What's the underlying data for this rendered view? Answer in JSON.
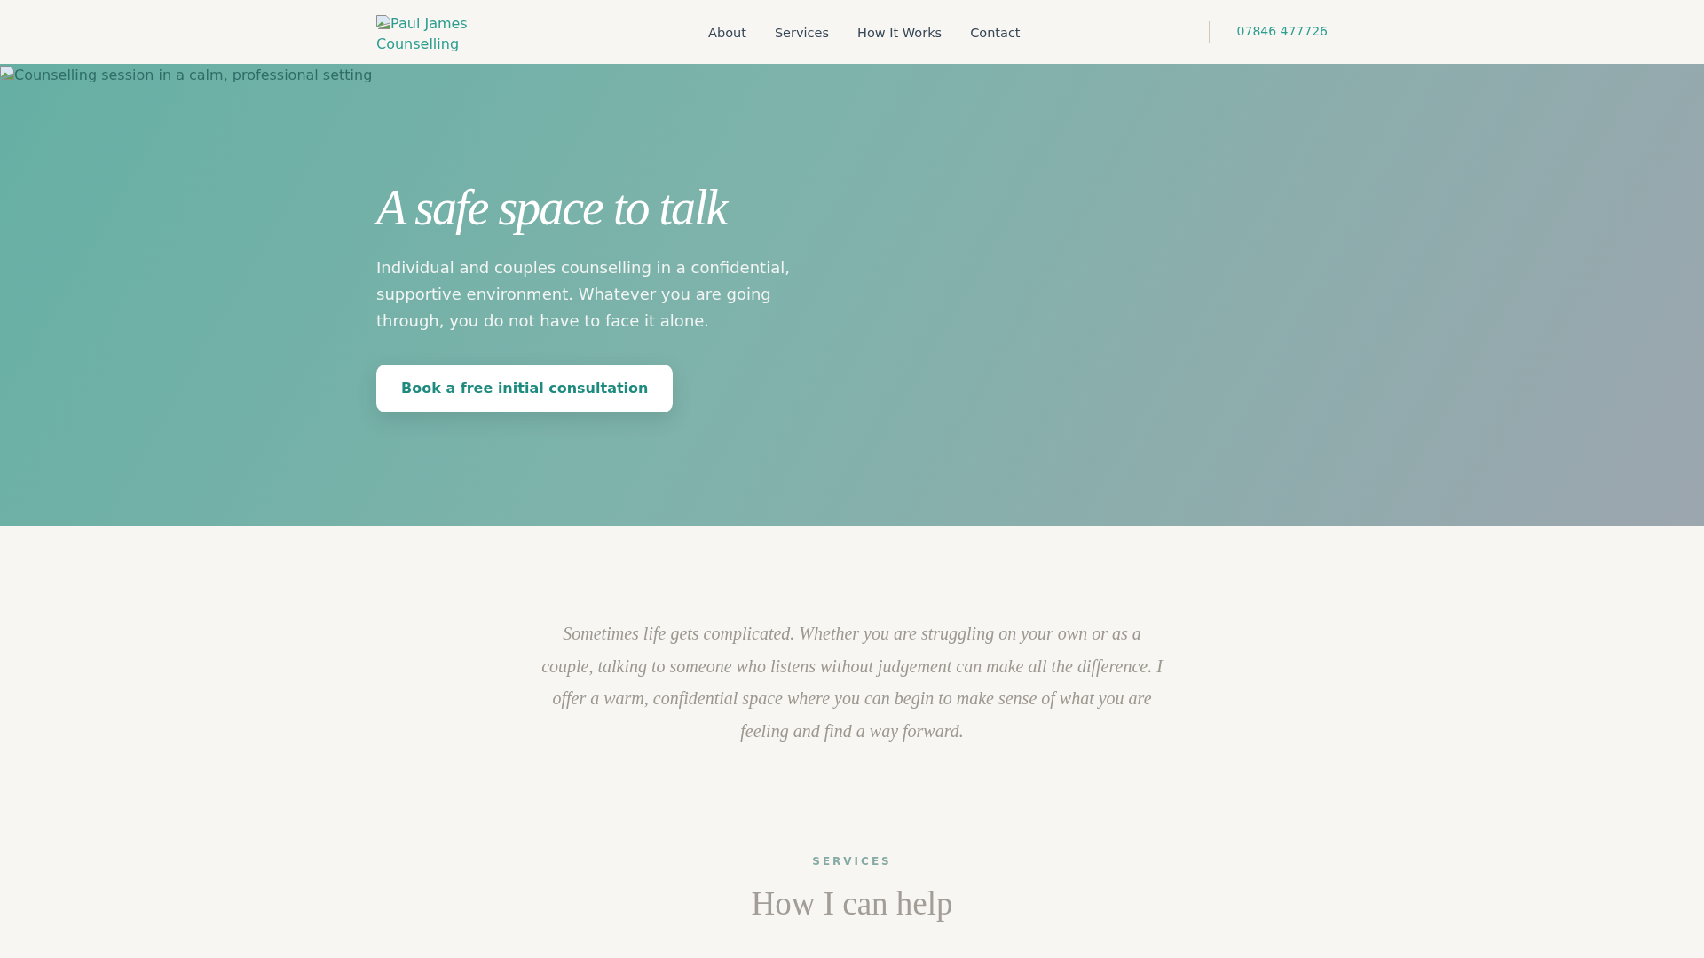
{
  "header": {
    "logo": {
      "alt_text": "Paul James Counselling"
    },
    "nav": [
      "About",
      "Services",
      "How It Works",
      "Contact"
    ],
    "phone": "07846 477726"
  },
  "hero": {
    "image_alt": "Counselling session in a calm, professional setting",
    "title": "A safe space to talk",
    "text": "Individual and couples counselling in a confidential, supportive environment. Whatever you are going through, you do not have to face it alone.",
    "button": "Book a free initial consultation"
  },
  "intro": {
    "text": "Sometimes life gets complicated. Whether you are struggling on your own or as a couple, talking to someone who listens without judgement can make all the difference. I offer a warm, confidential space where you can begin to make sense of what you are feeling and find a way forward."
  },
  "services": {
    "eyebrow": "SERVICES",
    "title": "How I can help"
  }
}
